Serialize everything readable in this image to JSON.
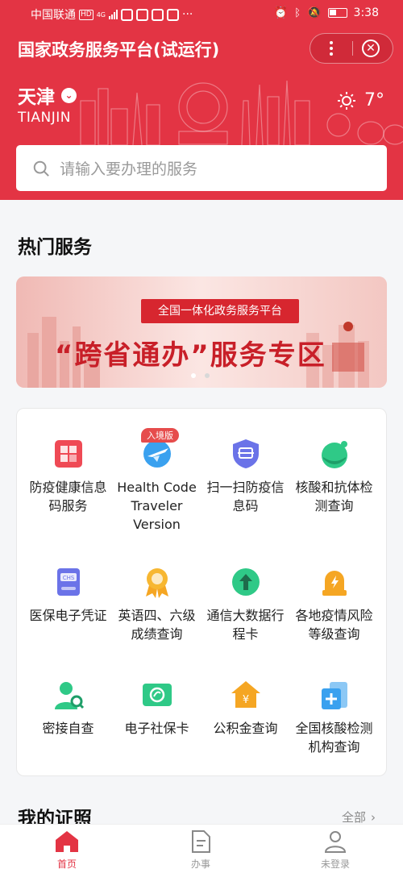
{
  "status_bar": {
    "carrier": "中国联通",
    "badge": "HD",
    "network": "4G",
    "time": "3:38"
  },
  "header": {
    "title": "国家政务服务平台(试运行)",
    "city_cn": "天津",
    "city_en": "TIANJIN",
    "temperature": "7°",
    "weather_icon": "sun-icon"
  },
  "search": {
    "placeholder": "请输入要办理的服务"
  },
  "hot_services": {
    "title": "热门服务",
    "banner": {
      "tag": "全国一体化政务服务平台",
      "headline": "“跨省通办”服务专区",
      "active_dot": 1,
      "dot_count": 2
    },
    "items": [
      {
        "label": "防疫健康信息码服务",
        "icon": "health-code-icon",
        "color": "#ef4a55"
      },
      {
        "label": "Health Code Traveler Version",
        "icon": "airplane-icon",
        "color": "#3aa1ef",
        "badge": "入境版"
      },
      {
        "label": "扫一扫防疫信息码",
        "icon": "scan-shield-icon",
        "color": "#6b73e8"
      },
      {
        "label": "核酸和抗体检测查询",
        "icon": "test-tube-icon",
        "color": "#2fc987"
      },
      {
        "label": "医保电子凭证",
        "icon": "medical-insurance-icon",
        "color": "#6b73e8"
      },
      {
        "label": "英语四、六级成绩查询",
        "icon": "medal-icon",
        "color": "#f5a623"
      },
      {
        "label": "通信大数据行程卡",
        "icon": "upload-arrow-icon",
        "color": "#2fc987"
      },
      {
        "label": "各地疫情风险等级查询",
        "icon": "warning-light-icon",
        "color": "#f5a623"
      },
      {
        "label": "密接自查",
        "icon": "contact-person-icon",
        "color": "#2fc987"
      },
      {
        "label": "电子社保卡",
        "icon": "social-card-icon",
        "color": "#2fc987"
      },
      {
        "label": "公积金查询",
        "icon": "housing-fund-icon",
        "color": "#f5a623"
      },
      {
        "label": "全国核酸检测机构查询",
        "icon": "medical-building-icon",
        "color": "#3aa1ef"
      }
    ]
  },
  "certificates": {
    "title": "我的证照",
    "more": "全部"
  },
  "tabbar": {
    "items": [
      {
        "label": "首页",
        "icon": "home-icon",
        "active": true
      },
      {
        "label": "办事",
        "icon": "document-icon",
        "active": false
      },
      {
        "label": "未登录",
        "icon": "user-icon",
        "active": false
      }
    ]
  },
  "colors": {
    "brand_red": "#e33444",
    "tab_active": "#e33444"
  }
}
